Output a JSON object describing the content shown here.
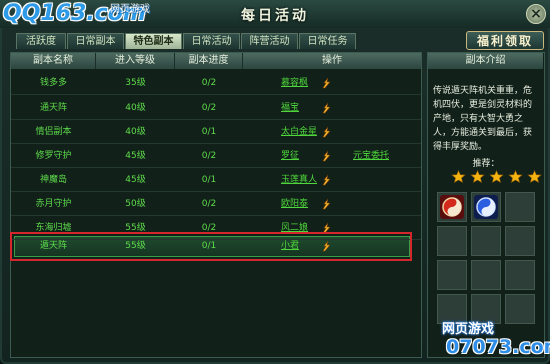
{
  "logo": {
    "brand": "QQ163.com",
    "sub": "网页游戏"
  },
  "window": {
    "title": "每日活动",
    "close": "×"
  },
  "tabs": [
    {
      "label": "活跃度",
      "active": false
    },
    {
      "label": "日常副本",
      "active": false
    },
    {
      "label": "特色副本",
      "active": true
    },
    {
      "label": "日常活动",
      "active": false
    },
    {
      "label": "阵营活动",
      "active": false
    },
    {
      "label": "日常任务",
      "active": false
    }
  ],
  "welfare_button": "福利领取",
  "table": {
    "headers": [
      "副本名称",
      "进入等级",
      "副本进度",
      "操作"
    ],
    "rows": [
      {
        "name": "钱多多",
        "level": "35级",
        "progress": "0/2",
        "op": "慕容枫",
        "entrust": ""
      },
      {
        "name": "通天阵",
        "level": "40级",
        "progress": "0/2",
        "op": "福宝",
        "entrust": ""
      },
      {
        "name": "情侣副本",
        "level": "40级",
        "progress": "0/1",
        "op": "太白金星",
        "entrust": ""
      },
      {
        "name": "修罗守护",
        "level": "45级",
        "progress": "0/2",
        "op": "罗征",
        "entrust": "元宝委托"
      },
      {
        "name": "神魔岛",
        "level": "45级",
        "progress": "0/1",
        "op": "玉莲真人",
        "entrust": ""
      },
      {
        "name": "赤月守护",
        "level": "50级",
        "progress": "0/2",
        "op": "欧阳泰",
        "entrust": ""
      },
      {
        "name": "东海归墟",
        "level": "55级",
        "progress": "0/2",
        "op": "风二娘",
        "entrust": ""
      },
      {
        "name": "遁天阵",
        "level": "55级",
        "progress": "0/1",
        "op": "小君",
        "entrust": ""
      }
    ]
  },
  "intro": {
    "header": "副本介绍",
    "text": "传说遁天阵机关重重，危机四伏，更是剑灵材料的产地，只有大智大勇之人，方能通关到最后，获得丰厚奖励。",
    "recommend_label": "推荐：",
    "stars": 5
  },
  "watermark": {
    "line1": "网页游戏",
    "line2": "07073.com"
  },
  "colors": {
    "accent_green": "#5fdc4b",
    "highlight_red": "#d3272b",
    "star": "#f5b312"
  }
}
